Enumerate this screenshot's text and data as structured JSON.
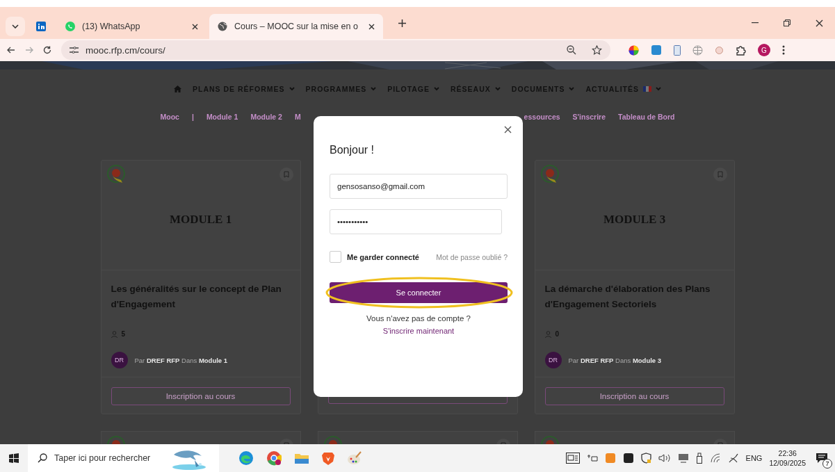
{
  "browser": {
    "tabs": [
      {
        "kind": "linkedin",
        "selected": false
      },
      {
        "kind": "whatsapp",
        "title": "(13) WhatsApp",
        "selected": false
      },
      {
        "kind": "page",
        "title": "Cours – MOOC sur la mise en o",
        "selected": true
      }
    ],
    "address": "mooc.rfp.cm/cours/",
    "profile_initial": "G"
  },
  "site": {
    "nav": [
      {
        "label": "PLANS DE RÉFORMES",
        "flag": false
      },
      {
        "label": "PROGRAMMES",
        "flag": false
      },
      {
        "label": "PILOTAGE",
        "flag": false
      },
      {
        "label": "RÉSEAUX",
        "flag": false
      },
      {
        "label": "DOCUMENTS",
        "flag": false
      },
      {
        "label": "ACTUALITÉS",
        "flag": true
      }
    ],
    "submenu_left": [
      "Mooc",
      "|",
      "Module 1",
      "Module 2",
      "M"
    ],
    "submenu_right": [
      "essources",
      "S'inscrire",
      "Tableau de Bord"
    ],
    "cards": [
      {
        "heading": "MODULE 1",
        "title": "Les généralités sur le concept de Plan d'Engagement",
        "count": "5",
        "avatar": "DR",
        "byline": "Par **DREF RFP** Dans **Module 1**",
        "button": "Inscription au cours"
      },
      {
        "heading": "MODULE 3",
        "title": "La démarche d'élaboration des Plans d'Engagement Sectoriels",
        "count": "0",
        "avatar": "DR",
        "byline": "Par **DREF RFP** Dans **Module 3**",
        "button": "Inscription au cours"
      }
    ]
  },
  "modal": {
    "title": "Bonjour !",
    "email": "gensosanso@gmail.com",
    "password": "•••••••••••",
    "remember": {
      "label": "Me garder connecté",
      "checked": false
    },
    "forgot": "Mot de passe oublié ?",
    "submit": "Se connecter",
    "highlighted": true,
    "prompt": "Vous n'avez pas de compte ?",
    "register": "S'inscrire maintenant"
  },
  "taskbar": {
    "search_placeholder": "Taper ici pour rechercher",
    "language": "ENG",
    "time": "22:36",
    "date": "12/09/2025",
    "notifications": "7"
  }
}
